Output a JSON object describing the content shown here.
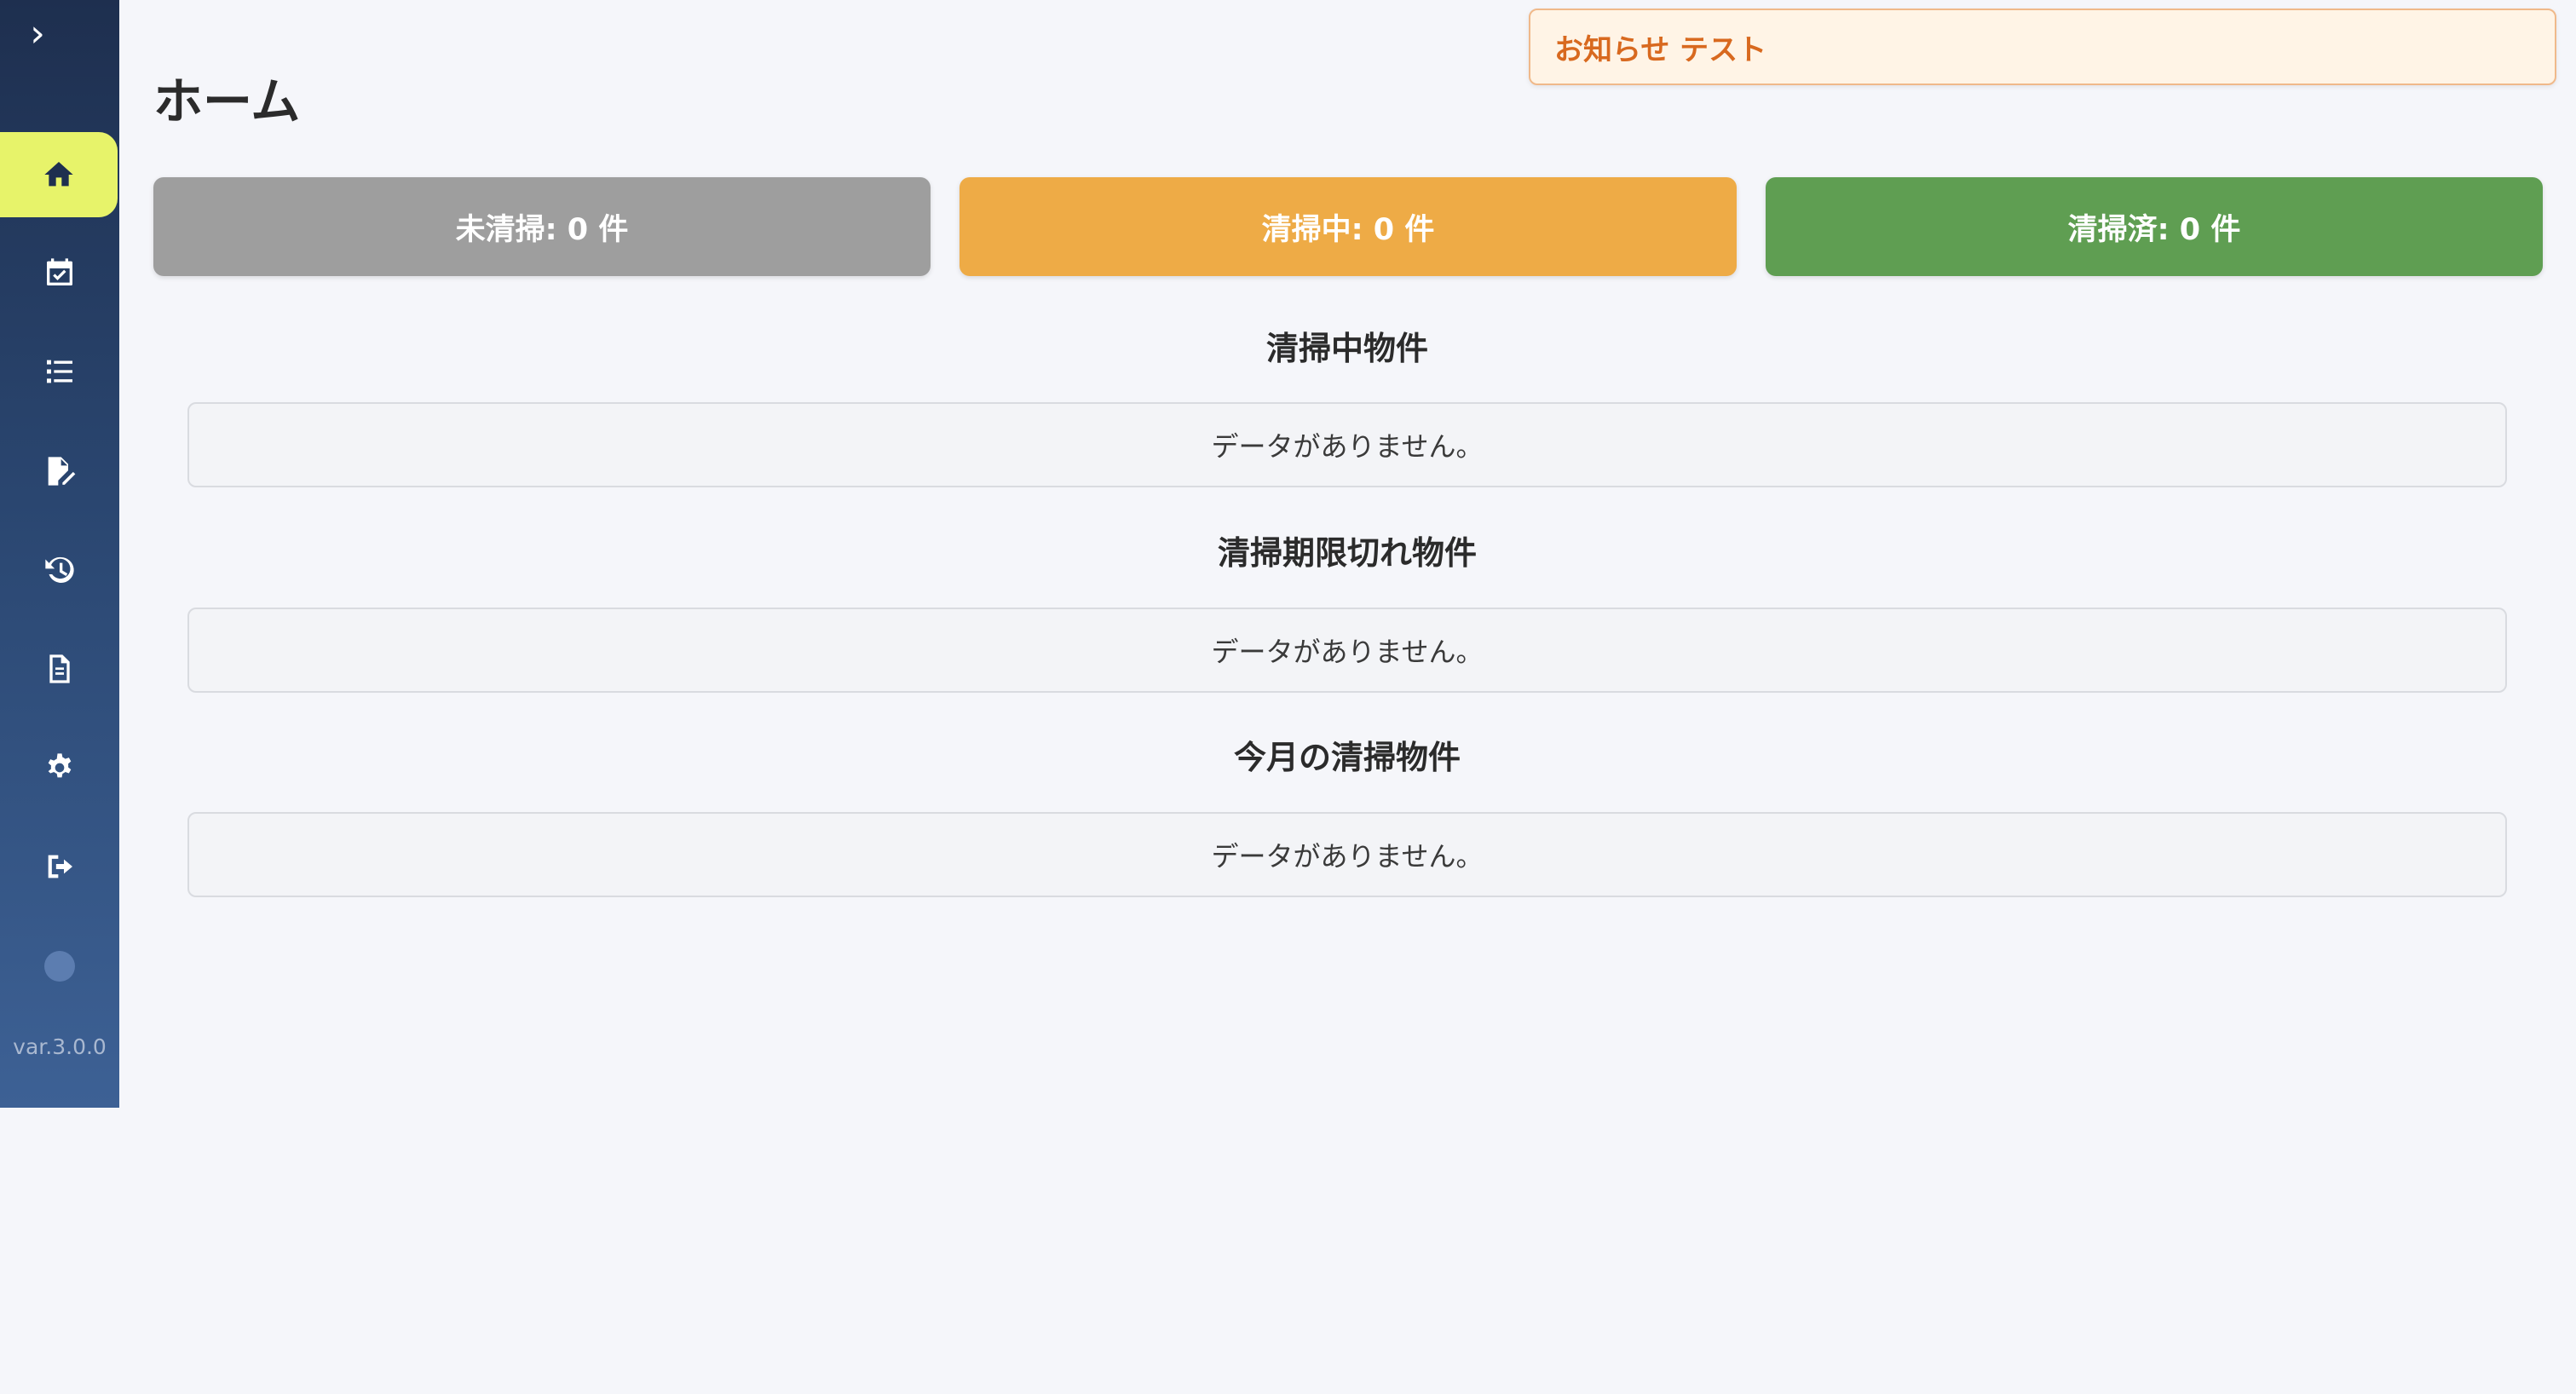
{
  "sidebar": {
    "toggle_icon": "chevron-right-icon",
    "items": [
      {
        "icon": "home-icon",
        "active": true
      },
      {
        "icon": "calendar-check-icon",
        "active": false
      },
      {
        "icon": "list-icon",
        "active": false
      },
      {
        "icon": "file-edit-icon",
        "active": false
      },
      {
        "icon": "history-icon",
        "active": false
      },
      {
        "icon": "document-icon",
        "active": false
      },
      {
        "icon": "gear-icon",
        "active": false
      },
      {
        "icon": "logout-icon",
        "active": false
      }
    ],
    "version": "var.3.0.0"
  },
  "header": {
    "title": "ホーム",
    "notice": "お知らせ テスト"
  },
  "status_cards": [
    {
      "label": "未清掃: 0 件",
      "color": "#9e9e9e"
    },
    {
      "label": "清掃中: 0 件",
      "color": "#eeab46"
    },
    {
      "label": "清掃済: 0 件",
      "color": "#5f9e52"
    }
  ],
  "sections": [
    {
      "title": "清掃中物件",
      "empty_text": "データがありません。"
    },
    {
      "title": "清掃期限切れ物件",
      "empty_text": "データがありません。"
    },
    {
      "title": "今月の清掃物件",
      "empty_text": "データがありません。"
    }
  ],
  "colors": {
    "sidebar_top": "#1e2f4f",
    "sidebar_bottom": "#3d6195",
    "active_item": "#e7f36a",
    "notice_text": "#d8691f"
  }
}
